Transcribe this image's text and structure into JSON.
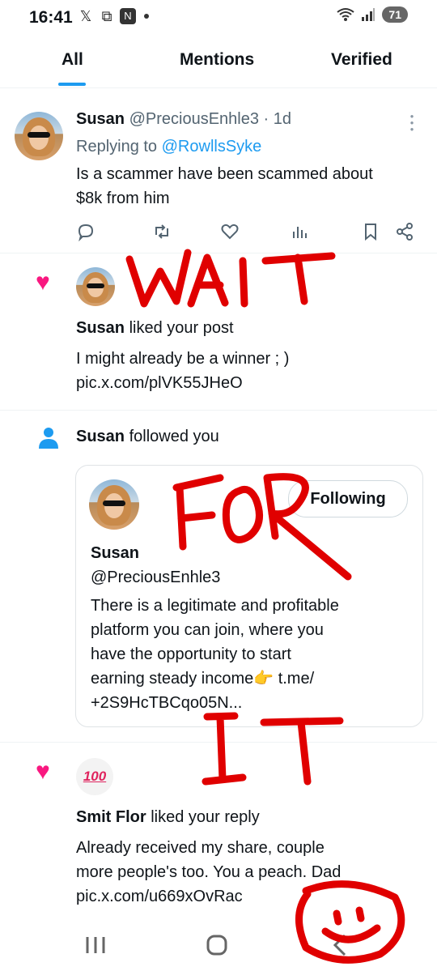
{
  "status": {
    "time": "16:41",
    "battery": "71",
    "colors": {
      "bar_icons": "#222222"
    }
  },
  "tabs": [
    {
      "label": "All",
      "active": true
    },
    {
      "label": "Mentions",
      "active": false
    },
    {
      "label": "Verified",
      "active": false
    }
  ],
  "reply": {
    "name": "Susan",
    "handle": "@PreciousEnhle3",
    "age": "· 1d",
    "replying_label": "Replying to",
    "replying_to": "@RowllsSyke",
    "body_line1": "Is a scammer have been scammed about",
    "body_line2": "$8k from him",
    "actions": [
      "reply-icon",
      "retweet-icon",
      "like-icon",
      "views-icon",
      "bookmark-icon",
      "share-icon"
    ]
  },
  "like1": {
    "name": "Susan",
    "action": "liked your post",
    "body": "I might already be a winner  ;    )",
    "link": "pic.x.com/plVK55JHeO"
  },
  "follow": {
    "name": "Susan",
    "action": "followed you",
    "card": {
      "button": "Following",
      "name": "Susan",
      "handle": "@PreciousEnhle3",
      "bio_line1": "There is a legitimate and profitable",
      "bio_line2": "platform you can join, where you",
      "bio_line3": "have the opportunity to start",
      "bio_line4": "earning steady income👉 t.me/",
      "bio_line5": "+2S9HcTBCqo05N..."
    }
  },
  "like2": {
    "avatar_text": "100",
    "name": "Smit Flor",
    "action": "liked your reply",
    "body_line1": "Already received my  share,  couple",
    "body_line2": "more people's too. You  a peach. Dad",
    "link": "pic.x.com/u669xOvRac"
  },
  "annotations": {
    "word1": "WAIT",
    "word2": "FOR",
    "word3": "IT",
    "color": "#e00000"
  },
  "colors": {
    "accent": "#1d9bf0",
    "like": "#f91880",
    "text": "#0f1419",
    "secondary": "#536471"
  }
}
